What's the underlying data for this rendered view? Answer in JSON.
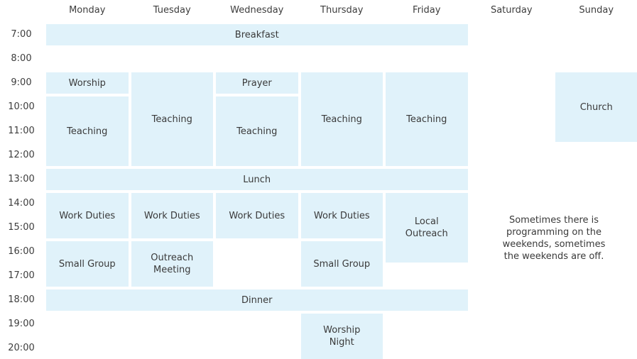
{
  "days": [
    "Monday",
    "Tuesday",
    "Wednesday",
    "Thursday",
    "Friday",
    "Saturday",
    "Sunday"
  ],
  "times": [
    "7:00",
    "8:00",
    "9:00",
    "10:00",
    "11:00",
    "12:00",
    "13:00",
    "14:00",
    "15:00",
    "16:00",
    "17:00",
    "18:00",
    "19:00",
    "20:00"
  ],
  "colors": {
    "event_fill": "#e0f2fa",
    "text": "#3a3a3a"
  },
  "events": [
    {
      "name": "breakfast",
      "label": "Breakfast",
      "day_start": 0,
      "day_end": 4,
      "start": "7:00",
      "end": "8:00"
    },
    {
      "name": "worship",
      "label": "Worship",
      "day_start": 0,
      "day_end": 0,
      "start": "9:00",
      "end": "10:00"
    },
    {
      "name": "teaching-monday",
      "label": "Teaching",
      "day_start": 0,
      "day_end": 0,
      "start": "10:00",
      "end": "13:00"
    },
    {
      "name": "teaching-tuesday",
      "label": "Teaching",
      "day_start": 1,
      "day_end": 1,
      "start": "9:00",
      "end": "13:00"
    },
    {
      "name": "prayer",
      "label": "Prayer",
      "day_start": 2,
      "day_end": 2,
      "start": "9:00",
      "end": "10:00"
    },
    {
      "name": "teaching-wednesday",
      "label": "Teaching",
      "day_start": 2,
      "day_end": 2,
      "start": "10:00",
      "end": "13:00"
    },
    {
      "name": "teaching-thursday",
      "label": "Teaching",
      "day_start": 3,
      "day_end": 3,
      "start": "9:00",
      "end": "13:00"
    },
    {
      "name": "teaching-friday",
      "label": "Teaching",
      "day_start": 4,
      "day_end": 4,
      "start": "9:00",
      "end": "13:00"
    },
    {
      "name": "church",
      "label": "Church",
      "day_start": 6,
      "day_end": 6,
      "start": "9:00",
      "end": "12:00"
    },
    {
      "name": "lunch",
      "label": "Lunch",
      "day_start": 0,
      "day_end": 4,
      "start": "13:00",
      "end": "14:00"
    },
    {
      "name": "work-duties-monday",
      "label": "Work Duties",
      "day_start": 0,
      "day_end": 0,
      "start": "14:00",
      "end": "16:00"
    },
    {
      "name": "work-duties-tuesday",
      "label": "Work Duties",
      "day_start": 1,
      "day_end": 1,
      "start": "14:00",
      "end": "16:00"
    },
    {
      "name": "work-duties-wednesday",
      "label": "Work Duties",
      "day_start": 2,
      "day_end": 2,
      "start": "14:00",
      "end": "16:00"
    },
    {
      "name": "work-duties-thursday",
      "label": "Work Duties",
      "day_start": 3,
      "day_end": 3,
      "start": "14:00",
      "end": "16:00"
    },
    {
      "name": "local-outreach",
      "label": "Local\nOutreach",
      "day_start": 4,
      "day_end": 4,
      "start": "14:00",
      "end": "17:00"
    },
    {
      "name": "small-group-monday",
      "label": "Small Group",
      "day_start": 0,
      "day_end": 0,
      "start": "16:00",
      "end": "18:00"
    },
    {
      "name": "outreach-meeting",
      "label": "Outreach\nMeeting",
      "day_start": 1,
      "day_end": 1,
      "start": "16:00",
      "end": "18:00"
    },
    {
      "name": "small-group-thursday",
      "label": "Small Group",
      "day_start": 3,
      "day_end": 3,
      "start": "16:00",
      "end": "18:00"
    },
    {
      "name": "dinner",
      "label": "Dinner",
      "day_start": 0,
      "day_end": 4,
      "start": "18:00",
      "end": "19:00"
    },
    {
      "name": "worship-night",
      "label": "Worship\nNight",
      "day_start": 3,
      "day_end": 3,
      "start": "19:00",
      "end": "21:00"
    }
  ],
  "weekend_note": "Sometimes there is\nprogramming on the\nweekends, sometimes\nthe weekends are off."
}
